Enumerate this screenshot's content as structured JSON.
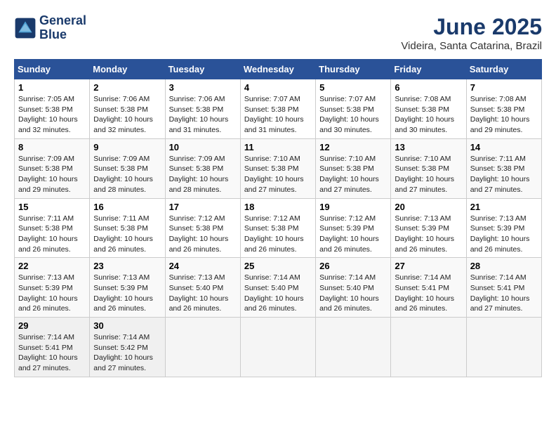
{
  "header": {
    "logo_line1": "General",
    "logo_line2": "Blue",
    "month": "June 2025",
    "location": "Videira, Santa Catarina, Brazil"
  },
  "weekdays": [
    "Sunday",
    "Monday",
    "Tuesday",
    "Wednesday",
    "Thursday",
    "Friday",
    "Saturday"
  ],
  "weeks": [
    [
      {
        "day": "1",
        "sunrise": "Sunrise: 7:05 AM",
        "sunset": "Sunset: 5:38 PM",
        "daylight": "Daylight: 10 hours and 32 minutes."
      },
      {
        "day": "2",
        "sunrise": "Sunrise: 7:06 AM",
        "sunset": "Sunset: 5:38 PM",
        "daylight": "Daylight: 10 hours and 32 minutes."
      },
      {
        "day": "3",
        "sunrise": "Sunrise: 7:06 AM",
        "sunset": "Sunset: 5:38 PM",
        "daylight": "Daylight: 10 hours and 31 minutes."
      },
      {
        "day": "4",
        "sunrise": "Sunrise: 7:07 AM",
        "sunset": "Sunset: 5:38 PM",
        "daylight": "Daylight: 10 hours and 31 minutes."
      },
      {
        "day": "5",
        "sunrise": "Sunrise: 7:07 AM",
        "sunset": "Sunset: 5:38 PM",
        "daylight": "Daylight: 10 hours and 30 minutes."
      },
      {
        "day": "6",
        "sunrise": "Sunrise: 7:08 AM",
        "sunset": "Sunset: 5:38 PM",
        "daylight": "Daylight: 10 hours and 30 minutes."
      },
      {
        "day": "7",
        "sunrise": "Sunrise: 7:08 AM",
        "sunset": "Sunset: 5:38 PM",
        "daylight": "Daylight: 10 hours and 29 minutes."
      }
    ],
    [
      {
        "day": "8",
        "sunrise": "Sunrise: 7:09 AM",
        "sunset": "Sunset: 5:38 PM",
        "daylight": "Daylight: 10 hours and 29 minutes."
      },
      {
        "day": "9",
        "sunrise": "Sunrise: 7:09 AM",
        "sunset": "Sunset: 5:38 PM",
        "daylight": "Daylight: 10 hours and 28 minutes."
      },
      {
        "day": "10",
        "sunrise": "Sunrise: 7:09 AM",
        "sunset": "Sunset: 5:38 PM",
        "daylight": "Daylight: 10 hours and 28 minutes."
      },
      {
        "day": "11",
        "sunrise": "Sunrise: 7:10 AM",
        "sunset": "Sunset: 5:38 PM",
        "daylight": "Daylight: 10 hours and 27 minutes."
      },
      {
        "day": "12",
        "sunrise": "Sunrise: 7:10 AM",
        "sunset": "Sunset: 5:38 PM",
        "daylight": "Daylight: 10 hours and 27 minutes."
      },
      {
        "day": "13",
        "sunrise": "Sunrise: 7:10 AM",
        "sunset": "Sunset: 5:38 PM",
        "daylight": "Daylight: 10 hours and 27 minutes."
      },
      {
        "day": "14",
        "sunrise": "Sunrise: 7:11 AM",
        "sunset": "Sunset: 5:38 PM",
        "daylight": "Daylight: 10 hours and 27 minutes."
      }
    ],
    [
      {
        "day": "15",
        "sunrise": "Sunrise: 7:11 AM",
        "sunset": "Sunset: 5:38 PM",
        "daylight": "Daylight: 10 hours and 26 minutes."
      },
      {
        "day": "16",
        "sunrise": "Sunrise: 7:11 AM",
        "sunset": "Sunset: 5:38 PM",
        "daylight": "Daylight: 10 hours and 26 minutes."
      },
      {
        "day": "17",
        "sunrise": "Sunrise: 7:12 AM",
        "sunset": "Sunset: 5:38 PM",
        "daylight": "Daylight: 10 hours and 26 minutes."
      },
      {
        "day": "18",
        "sunrise": "Sunrise: 7:12 AM",
        "sunset": "Sunset: 5:38 PM",
        "daylight": "Daylight: 10 hours and 26 minutes."
      },
      {
        "day": "19",
        "sunrise": "Sunrise: 7:12 AM",
        "sunset": "Sunset: 5:39 PM",
        "daylight": "Daylight: 10 hours and 26 minutes."
      },
      {
        "day": "20",
        "sunrise": "Sunrise: 7:13 AM",
        "sunset": "Sunset: 5:39 PM",
        "daylight": "Daylight: 10 hours and 26 minutes."
      },
      {
        "day": "21",
        "sunrise": "Sunrise: 7:13 AM",
        "sunset": "Sunset: 5:39 PM",
        "daylight": "Daylight: 10 hours and 26 minutes."
      }
    ],
    [
      {
        "day": "22",
        "sunrise": "Sunrise: 7:13 AM",
        "sunset": "Sunset: 5:39 PM",
        "daylight": "Daylight: 10 hours and 26 minutes."
      },
      {
        "day": "23",
        "sunrise": "Sunrise: 7:13 AM",
        "sunset": "Sunset: 5:39 PM",
        "daylight": "Daylight: 10 hours and 26 minutes."
      },
      {
        "day": "24",
        "sunrise": "Sunrise: 7:13 AM",
        "sunset": "Sunset: 5:40 PM",
        "daylight": "Daylight: 10 hours and 26 minutes."
      },
      {
        "day": "25",
        "sunrise": "Sunrise: 7:14 AM",
        "sunset": "Sunset: 5:40 PM",
        "daylight": "Daylight: 10 hours and 26 minutes."
      },
      {
        "day": "26",
        "sunrise": "Sunrise: 7:14 AM",
        "sunset": "Sunset: 5:40 PM",
        "daylight": "Daylight: 10 hours and 26 minutes."
      },
      {
        "day": "27",
        "sunrise": "Sunrise: 7:14 AM",
        "sunset": "Sunset: 5:41 PM",
        "daylight": "Daylight: 10 hours and 26 minutes."
      },
      {
        "day": "28",
        "sunrise": "Sunrise: 7:14 AM",
        "sunset": "Sunset: 5:41 PM",
        "daylight": "Daylight: 10 hours and 27 minutes."
      }
    ],
    [
      {
        "day": "29",
        "sunrise": "Sunrise: 7:14 AM",
        "sunset": "Sunset: 5:41 PM",
        "daylight": "Daylight: 10 hours and 27 minutes."
      },
      {
        "day": "30",
        "sunrise": "Sunrise: 7:14 AM",
        "sunset": "Sunset: 5:42 PM",
        "daylight": "Daylight: 10 hours and 27 minutes."
      },
      {
        "day": "",
        "sunrise": "",
        "sunset": "",
        "daylight": ""
      },
      {
        "day": "",
        "sunrise": "",
        "sunset": "",
        "daylight": ""
      },
      {
        "day": "",
        "sunrise": "",
        "sunset": "",
        "daylight": ""
      },
      {
        "day": "",
        "sunrise": "",
        "sunset": "",
        "daylight": ""
      },
      {
        "day": "",
        "sunrise": "",
        "sunset": "",
        "daylight": ""
      }
    ]
  ]
}
